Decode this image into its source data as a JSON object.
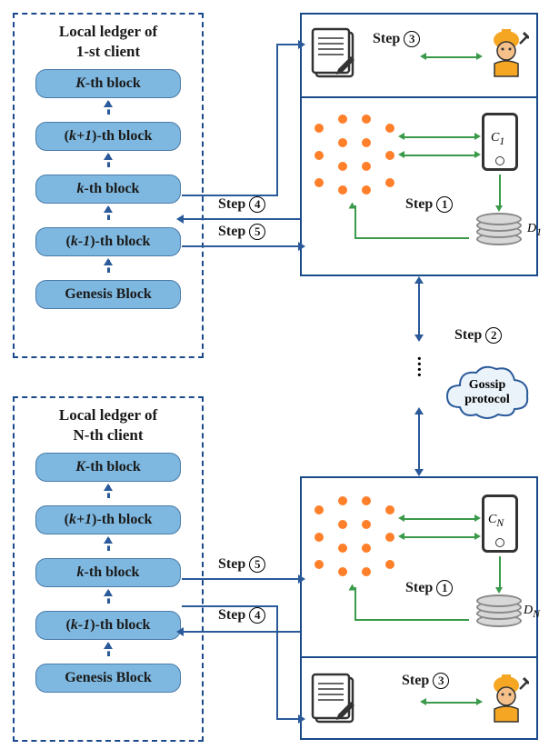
{
  "ledger1": {
    "title_line1": "Local ledger of",
    "title_line2_prefix": "1",
    "title_line2_suffix": "-st client",
    "blocks": [
      "K-th block",
      "(k+1)-th block",
      "k-th block",
      "(k-1)-th block",
      "Genesis Block"
    ]
  },
  "ledgerN": {
    "title_line1": "Local ledger of",
    "title_line2_prefix": "N",
    "title_line2_suffix": "-th client",
    "blocks": [
      "K-th block",
      "(k+1)-th block",
      "k-th block",
      "(k-1)-th block",
      "Genesis Block"
    ]
  },
  "steps": {
    "s1": {
      "w": "Step",
      "n": "1"
    },
    "s2": {
      "w": "Step",
      "n": "2"
    },
    "s3": {
      "w": "Step",
      "n": "3"
    },
    "s4": {
      "w": "Step",
      "n": "4"
    },
    "s5": {
      "w": "Step",
      "n": "5"
    }
  },
  "client1": {
    "C": "C",
    "Csub": "1",
    "D": "D",
    "Dsub": "1"
  },
  "clientN": {
    "C": "C",
    "Csub": "N",
    "D": "D",
    "Dsub": "N"
  },
  "cloud": {
    "l1": "Gossip",
    "l2": "protocol"
  }
}
